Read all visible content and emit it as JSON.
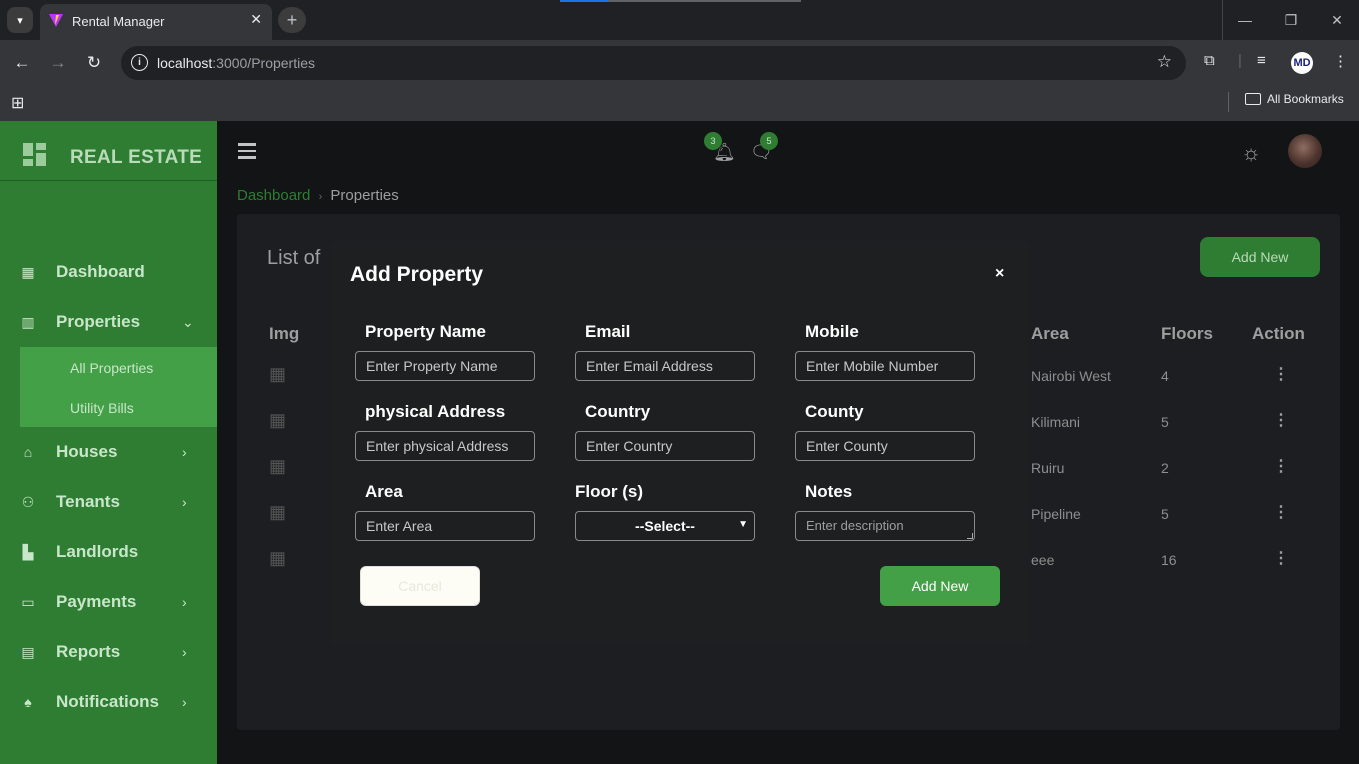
{
  "browser": {
    "tab_title": "Rental Manager",
    "tab_close": "✕",
    "new_tab": "+",
    "url_host": "localhost",
    "url_path": ":3000/Properties",
    "bookmarks_label": "All Bookmarks",
    "profile_initials": "MD"
  },
  "sidebar": {
    "brand": "REAL ESTATE",
    "items": [
      {
        "label": "Dashboard",
        "icon": "dashboard-icon"
      },
      {
        "label": "Properties",
        "icon": "building-icon"
      },
      {
        "label": "Houses",
        "icon": "home-icon"
      },
      {
        "label": "Tenants",
        "icon": "users-icon"
      },
      {
        "label": "Landlords",
        "icon": "landlord-icon"
      },
      {
        "label": "Payments",
        "icon": "payment-card-icon"
      },
      {
        "label": "Reports",
        "icon": "report-icon"
      },
      {
        "label": "Notifications",
        "icon": "bell-icon"
      }
    ],
    "submenu": [
      "All Properties",
      "Utility Bills"
    ]
  },
  "header": {
    "notifications_count": "3",
    "messages_count": "5"
  },
  "breadcrumb": {
    "parent": "Dashboard",
    "current": "Properties"
  },
  "page": {
    "title_partial": "List of",
    "add_new": "Add New",
    "columns": [
      "Img",
      "Area",
      "Floors",
      "Action"
    ],
    "rows": [
      {
        "area": "Nairobi West",
        "floors": "4"
      },
      {
        "area": "Kilimani",
        "floors": "5"
      },
      {
        "area": "Ruiru",
        "floors": "2"
      },
      {
        "area": "Pipeline",
        "floors": "5"
      },
      {
        "area": "eee",
        "floors": "16"
      }
    ]
  },
  "modal": {
    "title": "Add Property",
    "close": "×",
    "fields": {
      "property_name": {
        "label": "Property Name",
        "placeholder": "Enter Property Name"
      },
      "email": {
        "label": "Email",
        "placeholder": "Enter Email Address"
      },
      "mobile": {
        "label": "Mobile",
        "placeholder": "Enter Mobile Number"
      },
      "physical_address": {
        "label": "physical Address",
        "placeholder": "Enter physical Address"
      },
      "country": {
        "label": "Country",
        "placeholder": "Enter Country"
      },
      "county": {
        "label": "County",
        "placeholder": "Enter County"
      },
      "area": {
        "label": "Area",
        "placeholder": "Enter Area"
      },
      "floors": {
        "label": "Floor (s)",
        "selected": "--Select--"
      },
      "notes": {
        "label": "Notes",
        "placeholder": "Enter description"
      }
    },
    "cancel": "Cancel",
    "submit": "Add New"
  },
  "colors": {
    "sidebar_bg": "#2e7d32",
    "accent": "#43a047",
    "modal_bg": "#1e1f21",
    "page_bg": "#131416"
  }
}
